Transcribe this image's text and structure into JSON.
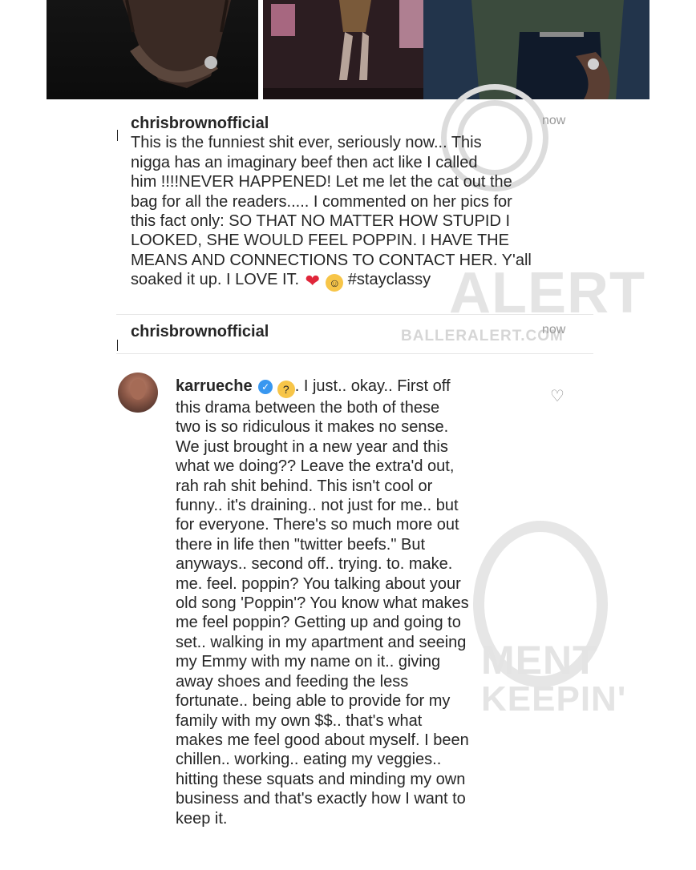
{
  "comments": [
    {
      "username": "chrisbrownofficial",
      "time": "now",
      "text": "This is the funniest shit ever, seriously now... This\nnigga has an imaginary beef then act like I called\nhim !!!!NEVER HAPPENED! Let me let the cat out the\nbag for all the readers..... I commented on her pics for\nthis fact only: SO THAT NO MATTER HOW STUPID I\nLOOKED, SHE WOULD FEEL POPPIN. I HAVE THE\nMEANS AND CONNECTIONS TO CONTACT HER. Y'all\nsoaked it up. I LOVE IT.",
      "hashtag": "#stayclassy"
    },
    {
      "username": "chrisbrownofficial",
      "time": "now"
    },
    {
      "username": "karrueche",
      "intro": ". I just.. okay.. First off",
      "text": "this drama between the both of these\ntwo is so ridiculous it makes no sense.\nWe just brought in a new year and this\nwhat we doing?? Leave the extra'd out,\nrah rah  shit behind. This isn't cool or\nfunny.. it's draining.. not just for me.. but\nfor everyone. There's so much more out\nthere in life then \"twitter beefs.\" But\nanyways.. second off.. trying. to. make.\nme. feel. poppin? You talking about your\nold song 'Poppin'? You know what makes\nme feel poppin? Getting up and going to\nset.. walking in my apartment and seeing\nmy Emmy with my name on it.. giving\naway shoes and feeding the less\nfortunate.. being able to provide for my\nfamily with my own $$.. that's what\nmakes me feel good about myself. I been\nchillen.. working.. eating my veggies..\nhitting these squats and minding my own\nbusiness and that's exactly how I want to\nkeep it."
    }
  ],
  "watermarks": {
    "top": "BALLERALERT.COM",
    "top_big": "ALERT",
    "bottom_1": "MENT",
    "bottom_2": "KEEPIN'"
  },
  "icons": {
    "heart": "heart-outline-icon",
    "verified": "verified-badge-icon",
    "emoji_heart": "red-heart-emoji",
    "emoji_wink": "winking-tongue-emoji",
    "emoji_think": "thinking-face-emoji"
  }
}
